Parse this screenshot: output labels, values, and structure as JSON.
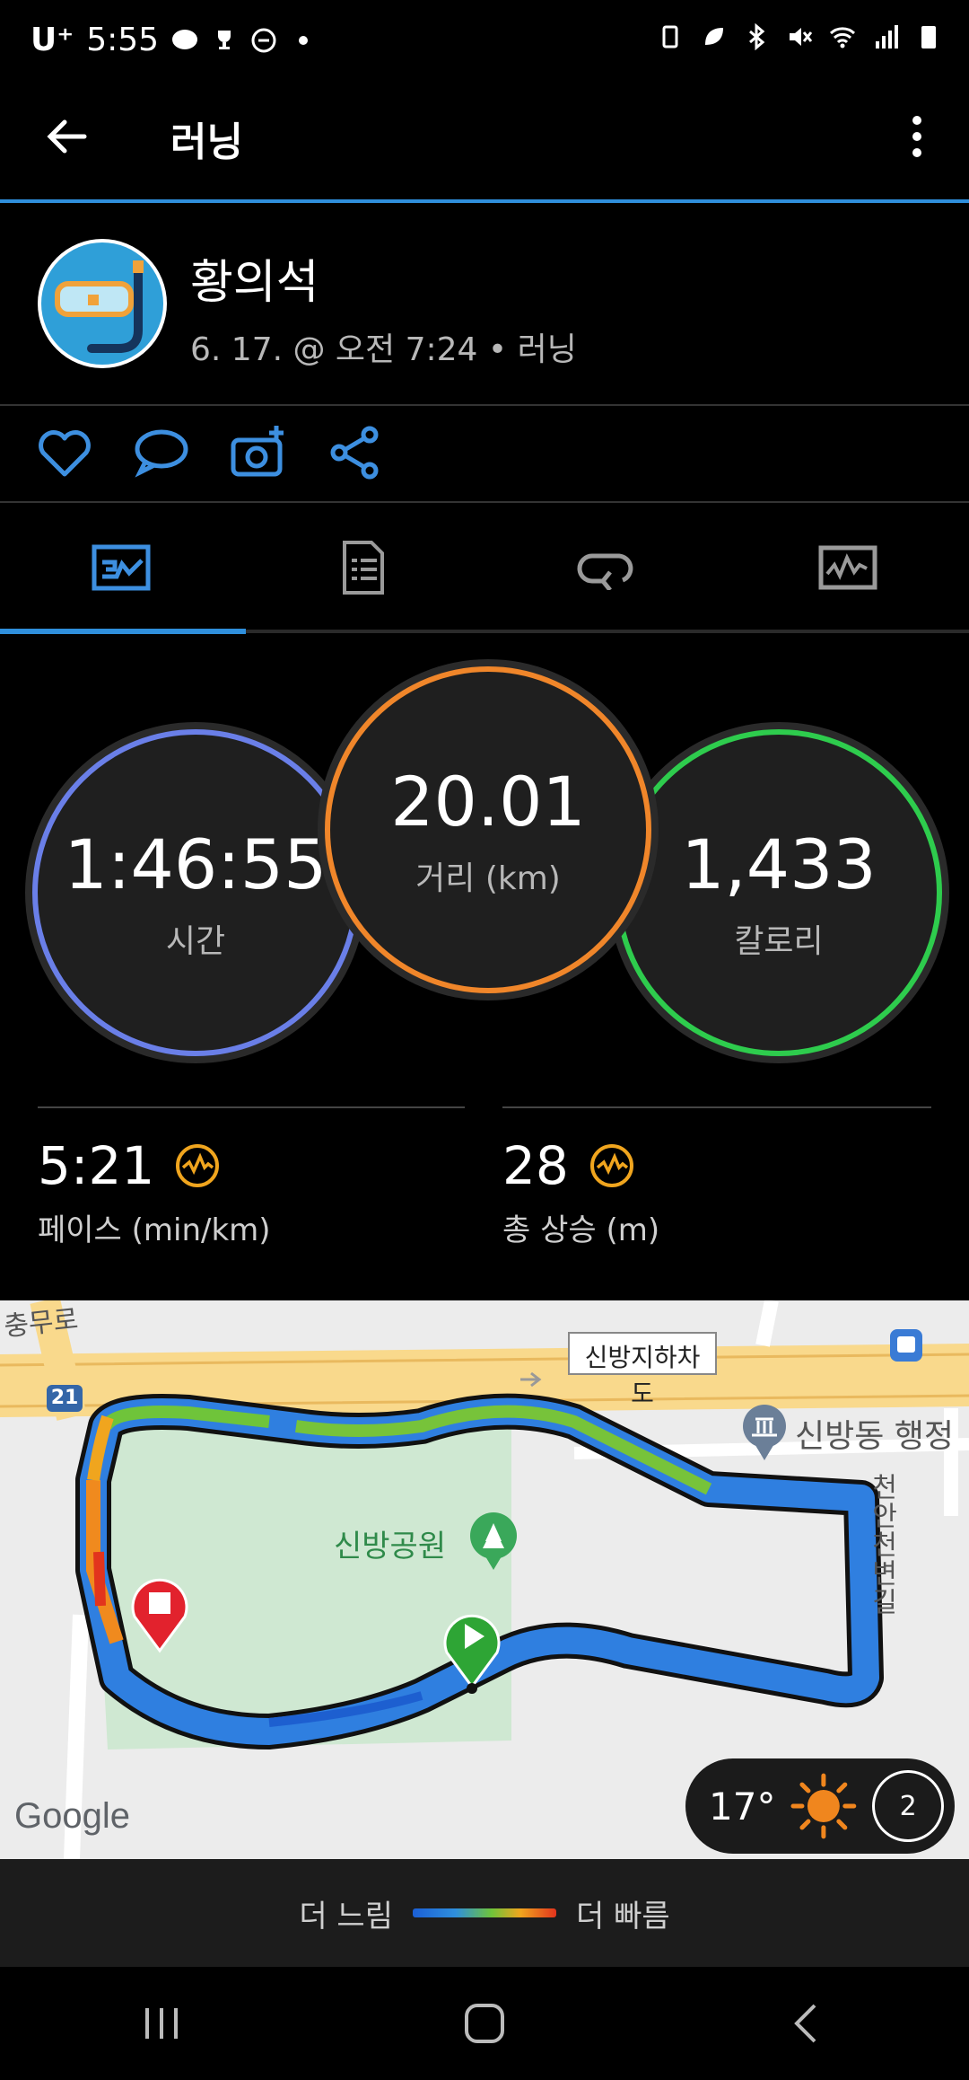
{
  "status": {
    "carrier": "U⁺",
    "time": "5:55"
  },
  "header": {
    "title": "러닝"
  },
  "activity": {
    "user_name": "황의석",
    "meta": "6. 17. @ 오전 7:24 • 러닝"
  },
  "metrics": {
    "time_value": "1:46:55",
    "time_label": "시간",
    "distance_value": "20.01",
    "distance_label": "거리 (km)",
    "calories_value": "1,433",
    "calories_label": "칼로리",
    "pace_value": "5:21",
    "pace_label": "페이스 (min/km)",
    "ascent_value": "28",
    "ascent_label": "총 상승 (m)"
  },
  "map": {
    "road_label": "신방지하차도",
    "road_partial": "충무로",
    "route_number": "21",
    "park_label": "신방공원",
    "office_label": "신방동 행정",
    "stream_label": "천안천변길",
    "google": "Google"
  },
  "weather": {
    "temp": "17°",
    "wind": "2"
  },
  "legend": {
    "slow": "더 느림",
    "fast": "더 빠름"
  },
  "colors": {
    "accent": "#2f8fdc",
    "distance": "#f0862a",
    "calories": "#2ecc4d",
    "time": "#6a7fe8"
  }
}
